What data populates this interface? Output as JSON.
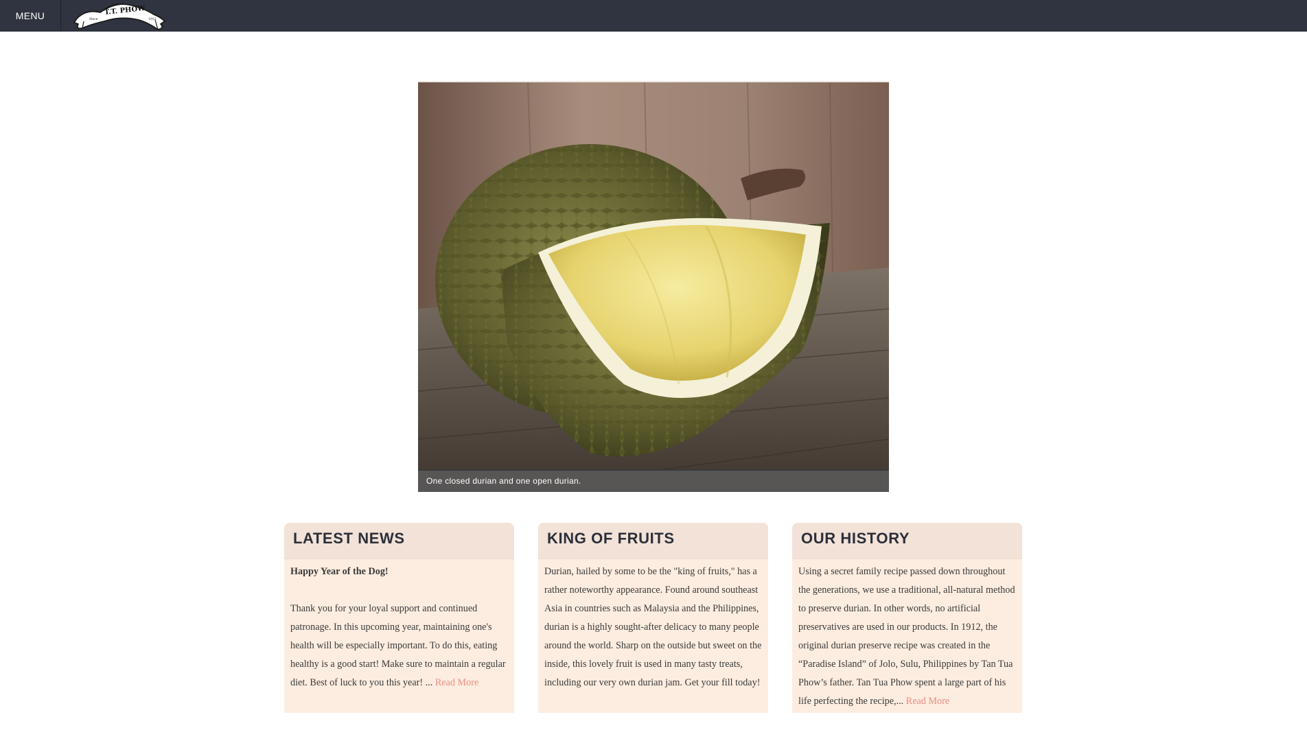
{
  "nav": {
    "menu_label": "MENU",
    "logo": {
      "name": "T.T. PHOW",
      "since_left": "Since",
      "since_right": "1912"
    }
  },
  "hero": {
    "caption": "One closed durian and one open durian."
  },
  "cards": {
    "news": {
      "title": "LATEST NEWS",
      "headline": "Happy Year of the Dog!",
      "text": "Thank you for your loyal support and continued patronage. In this upcoming year, maintaining one's health will be especially important. To do this, eating healthy is a good start! Make sure to maintain a regular diet. Best of luck to you this year! ...",
      "read_more": "Read More"
    },
    "fruits": {
      "title": "KING OF FRUITS",
      "text": "Durian, hailed by some to be the \"king of fruits,\" has a rather noteworthy appearance. Found around southeast Asia in countries such as Malaysia and the Philippines, durian is a highly sought-after delicacy to many people around the world. Sharp on the outside but sweet on the inside, this lovely fruit is used in many tasty treats, including our very own durian jam. Get your fill today!"
    },
    "history": {
      "title": "OUR HISTORY",
      "text": "Using a secret family recipe passed down throughout the generations, we use a traditional, all-natural method to preserve durian. In other words, no artificial preservatives are used in our products. In 1912, the original durian preserve recipe was created in the “Paradise Island” of Jolo, Sulu, Philippines by Tan Tua Phow’s father. Tan Tua Phow spent a large part of his life perfecting the recipe,...",
      "read_more": "Read More"
    }
  },
  "colors": {
    "nav_bg": "#2f3440",
    "card_bg": "#fdede0",
    "card_header_bg": "#f2e2d7",
    "title_text": "#2b2f3a",
    "link": "#ec8d82"
  },
  "icons": {
    "logo": "ribbon-banner-logo"
  }
}
